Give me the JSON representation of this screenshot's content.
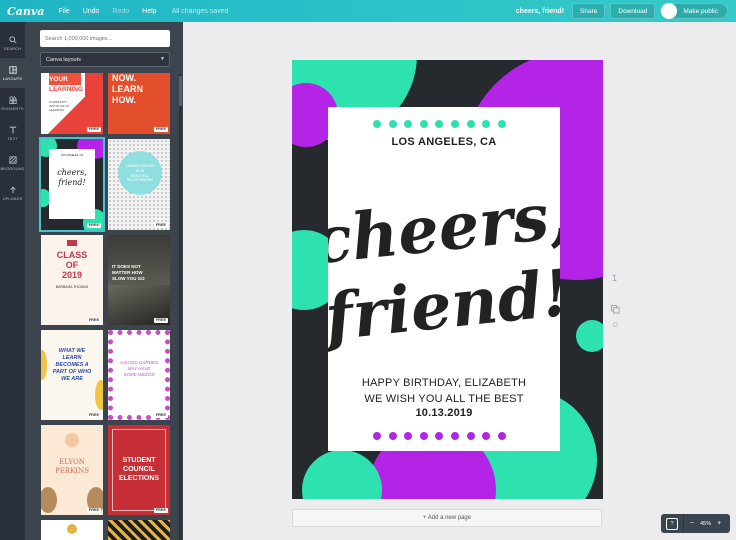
{
  "topbar": {
    "logo": "Canva",
    "menu": [
      "File",
      "Undo",
      "Redo",
      "Help"
    ],
    "status": "All changes saved",
    "doc_title": "cheers, friend!",
    "share_label": "Share",
    "download_label": "Download",
    "public_label": "Make public"
  },
  "sidebar": {
    "items": [
      {
        "label": "SEARCH",
        "icon": "search-icon"
      },
      {
        "label": "LAYOUTS",
        "icon": "layouts-icon"
      },
      {
        "label": "ELEMENTS",
        "icon": "elements-icon"
      },
      {
        "label": "TEXT",
        "icon": "text-icon"
      },
      {
        "label": "BKGROUND",
        "icon": "background-icon"
      },
      {
        "label": "UPLOADS",
        "icon": "uploads-icon"
      }
    ]
  },
  "panel": {
    "search_placeholder": "Search 1,000,000 images...",
    "dropdown_value": "Canva layouts",
    "free_label": "FREE",
    "thumbs": [
      {
        "t1": "YOUR",
        "t2": "LEARNING",
        "t3": "COMMUNITY INSTITUTE OF LEARNING"
      },
      {
        "t1": "NOW.",
        "t2": "LEARN",
        "t3": "HOW."
      },
      {
        "t1": "cheers,",
        "t2": "friend!",
        "t3": "LOS ANGELES, CA"
      },
      {
        "t1": "CHANGE AROUND",
        "t2": "AS IN",
        "t3": "BEAUTIFUL RELATIONSHIPS"
      },
      {
        "t1": "CLASS",
        "t2": "OF",
        "t3": "2019",
        "t4": "BARBARA THOMAS"
      },
      {
        "t1": "IT DOES NOT",
        "t2": "MATTER HOW",
        "t3": "SLOW YOU GO"
      },
      {
        "t1": "WHAT WE",
        "t2": "LEARN",
        "t3": "BECOMES A",
        "t4": "PART OF WHO",
        "t5": "WE ARE"
      },
      {
        "t1": "A GOOD GARDEN",
        "t2": "MAY HAVE",
        "t3": "SOME WEEDS"
      },
      {
        "t1": "ELYON",
        "t2": "PERKINS"
      },
      {
        "t1": "STUDENT",
        "t2": "COUNCIL",
        "t3": "ELECTIONS"
      }
    ]
  },
  "design": {
    "location": "LOS ANGELES, CA",
    "script_line1": "cheers,",
    "script_line2": "friend!",
    "line1": "HAPPY BIRTHDAY, ELIZABETH",
    "line2": "WE WISH YOU ALL THE BEST",
    "line3": "10.13.2019",
    "colors": {
      "teal": "#2ee2b0",
      "purple": "#b324e6",
      "dark": "#262a2e"
    }
  },
  "canvas": {
    "add_page_label": "+ Add a new page",
    "page_number": "1",
    "zoom": "45%",
    "zoom_minus": "−",
    "zoom_plus": "+",
    "help_label": "?"
  }
}
